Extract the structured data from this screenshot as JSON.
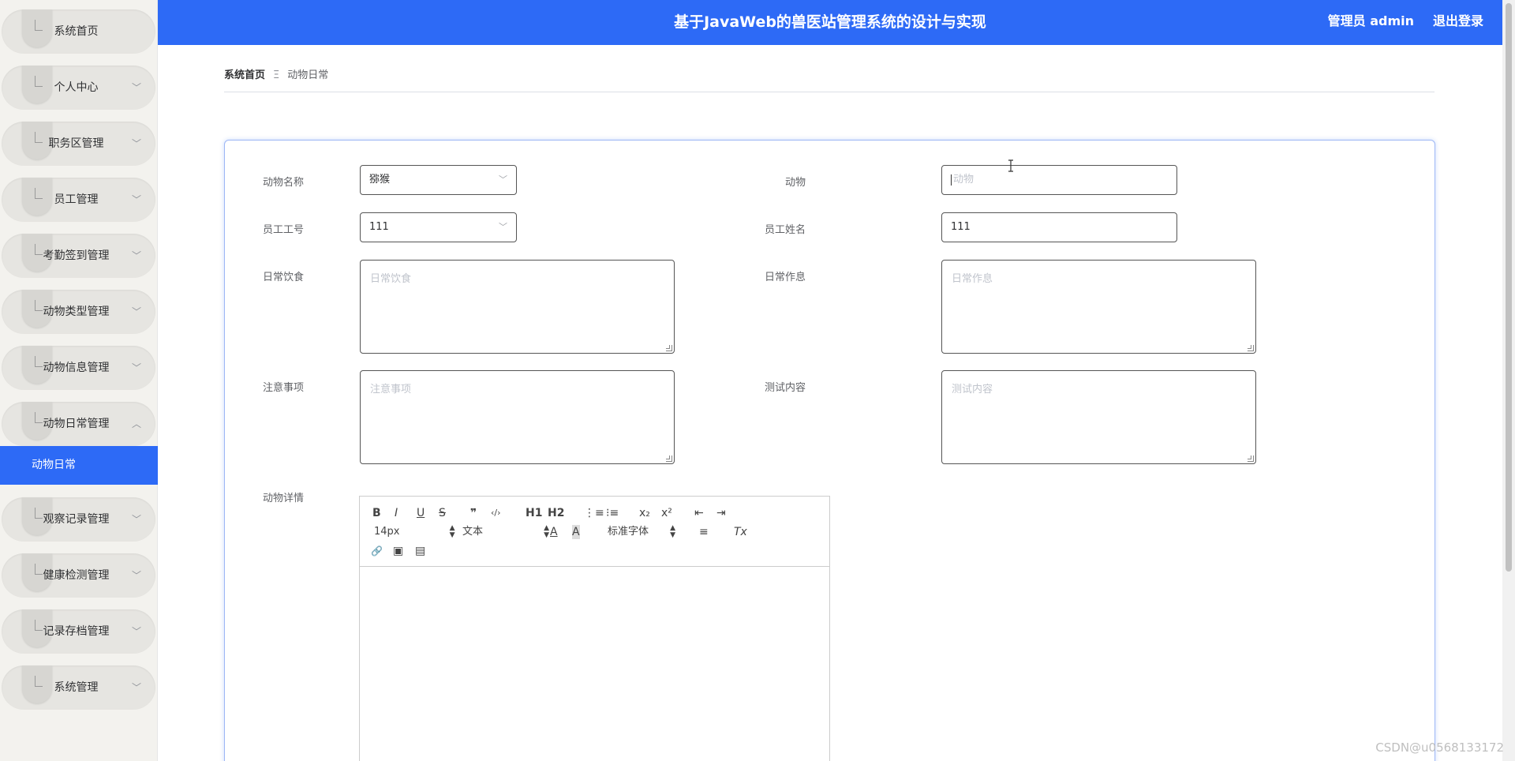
{
  "sidebar": {
    "items": [
      {
        "label": "系统首页",
        "has_arrow": false
      },
      {
        "label": "个人中心",
        "has_arrow": true,
        "arrow": "down"
      },
      {
        "label": "职务区管理",
        "has_arrow": true,
        "arrow": "down"
      },
      {
        "label": "员工管理",
        "has_arrow": true,
        "arrow": "down"
      },
      {
        "label": "考勤签到管理",
        "has_arrow": true,
        "arrow": "down"
      },
      {
        "label": "动物类型管理",
        "has_arrow": true,
        "arrow": "down"
      },
      {
        "label": "动物信息管理",
        "has_arrow": true,
        "arrow": "down"
      },
      {
        "label": "动物日常管理",
        "has_arrow": true,
        "arrow": "up"
      },
      {
        "label": "观察记录管理",
        "has_arrow": true,
        "arrow": "down"
      },
      {
        "label": "健康检测管理",
        "has_arrow": true,
        "arrow": "down"
      },
      {
        "label": "记录存档管理",
        "has_arrow": true,
        "arrow": "down"
      },
      {
        "label": "系统管理",
        "has_arrow": true,
        "arrow": "down"
      }
    ],
    "active_submenu": "动物日常"
  },
  "header": {
    "title": "基于JavaWeb的兽医站管理系统的设计与实现",
    "user": "管理员 admin",
    "logout": "退出登录"
  },
  "breadcrumb": {
    "home": "系统首页",
    "separator": "Ξ",
    "current": "动物日常"
  },
  "form": {
    "animal_name": {
      "label": "动物名称",
      "value": "猕猴"
    },
    "animal": {
      "label": "动物",
      "placeholder": "动物"
    },
    "staff_id": {
      "label": "员工工号",
      "value": "111"
    },
    "staff_name": {
      "label": "员工姓名",
      "value": "111"
    },
    "daily_diet": {
      "label": "日常饮食",
      "placeholder": "日常饮食"
    },
    "daily_routine": {
      "label": "日常作息",
      "placeholder": "日常作息"
    },
    "notes": {
      "label": "注意事项",
      "placeholder": "注意事项"
    },
    "test_content": {
      "label": "测试内容",
      "placeholder": "测试内容"
    },
    "details": {
      "label": "动物详情"
    }
  },
  "editor": {
    "toolbar": {
      "bold": "B",
      "italic": "I",
      "underline": "U",
      "strike": "S",
      "quote": "❞",
      "code": "‹/›",
      "h1": "H1",
      "h2": "H2",
      "ordered_list": "⋮≡",
      "bullet_list": "⁝≡",
      "subscript": "x₂",
      "superscript": "x²",
      "outdent": "⇤",
      "indent": "⇥",
      "size": "14px",
      "header_select": "文本",
      "color": "A",
      "background": "A",
      "font": "标准字体",
      "align": "≡",
      "clean": "Tx",
      "link": "🔗",
      "image": "▣",
      "video": "▤"
    }
  },
  "watermark": "CSDN@u0568133172",
  "colors": {
    "primary": "#2d6af6",
    "sidebar_bg": "#f3f2ee"
  }
}
